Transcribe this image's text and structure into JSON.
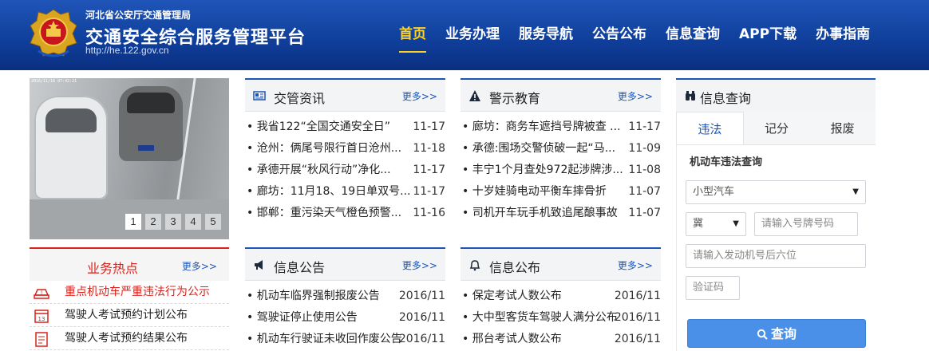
{
  "header": {
    "org": "河北省公安厅交通管理局",
    "title": "交通安全综合服务管理平台",
    "url": "http://he.122.gov.cn",
    "nav": [
      "首页",
      "业务办理",
      "服务导航",
      "公告公布",
      "信息查询",
      "APP下载",
      "办事指南"
    ]
  },
  "carousel": {
    "stamp": "2016/11/16 07:42:21",
    "pages": [
      "1",
      "2",
      "3",
      "4",
      "5"
    ],
    "current": "1"
  },
  "news": {
    "title": "交管资讯",
    "more": "更多>>",
    "items": [
      {
        "t": "我省122“全国交通安全日”",
        "d": "11-17"
      },
      {
        "t": "沧州：俩尾号限行首日沧州...",
        "d": "11-18"
      },
      {
        "t": "承德开展“秋风行动”净化...",
        "d": "11-17"
      },
      {
        "t": "廊坊：11月18、19日单双号...",
        "d": "11-17"
      },
      {
        "t": "邯郸：重污染天气橙色预警...",
        "d": "11-16"
      }
    ]
  },
  "warning": {
    "title": "警示教育",
    "more": "更多>>",
    "items": [
      {
        "t": "廊坊：商务车遮挡号牌被查 ...",
        "d": "11-17"
      },
      {
        "t": "承德:围场交警侦破一起“马...",
        "d": "11-09"
      },
      {
        "t": "丰宁1个月查处972起涉牌涉...",
        "d": "11-08"
      },
      {
        "t": "十岁娃骑电动平衡车摔骨折",
        "d": "11-07"
      },
      {
        "t": "司机开车玩手机致追尾酿事故",
        "d": "11-07"
      }
    ]
  },
  "hot": {
    "title": "业务热点",
    "more": "更多>>",
    "items": [
      {
        "t": "重点机动车严重违法行为公示",
        "icon": "warning-car-icon"
      },
      {
        "t": "驾驶人考试预约计划公布",
        "icon": "calendar-icon"
      },
      {
        "t": "驾驶人考试预约结果公布",
        "icon": "document-icon"
      }
    ]
  },
  "notice": {
    "title": "信息公告",
    "more": "更多>>",
    "items": [
      {
        "t": "机动车临界强制报废公告",
        "d": "2016/11"
      },
      {
        "t": "驾驶证停止使用公告",
        "d": "2016/11"
      },
      {
        "t": "机动车行驶证未收回作废公告",
        "d": "2016/11"
      }
    ]
  },
  "publish": {
    "title": "信息公布",
    "more": "更多>>",
    "items": [
      {
        "t": "保定考试人数公布",
        "d": "2016/11"
      },
      {
        "t": "大中型客货车驾驶人满分公布",
        "d": "2016/11"
      },
      {
        "t": "邢台考试人数公布",
        "d": "2016/11"
      }
    ]
  },
  "query": {
    "title": "信息查询",
    "tabs": [
      "违法",
      "记分",
      "报废"
    ],
    "active_tab": "违法",
    "label": "机动车违法查询",
    "vehicle_type": "小型汽车",
    "province": "冀",
    "plate_placeholder": "请输入号牌号码",
    "engine_placeholder": "请输入发动机号后六位",
    "captcha_placeholder": "验证码",
    "button": "查询"
  },
  "colors": {
    "brand": "#1c55b8",
    "accent": "#ffd21f",
    "hot": "#d9221c",
    "button": "#4a8fe8"
  }
}
